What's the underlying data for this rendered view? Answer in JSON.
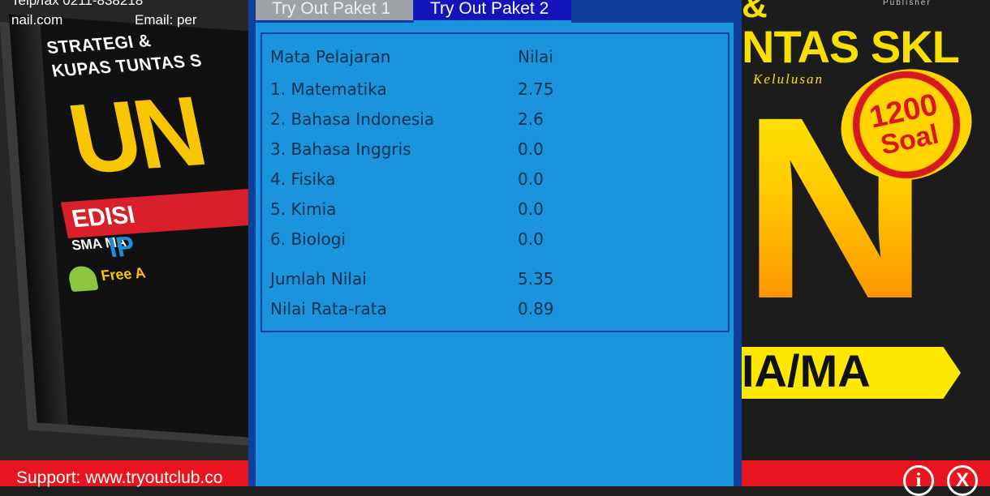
{
  "background_left": {
    "contact_top": "Telp/fax 0211-838218",
    "contact_email_left": "nail.com",
    "contact_email_right": "Email: per",
    "book_line1": "STRATEGI &",
    "book_line2": "KUPAS TUNTAS S",
    "book_big": "UN",
    "book_edition": "EDISI",
    "book_level": "SMA MA",
    "book_program": "IP",
    "book_free": "Free A"
  },
  "background_right": {
    "publisher": "Publisher",
    "amp": "&",
    "title": "NTAS SKL",
    "subtitle": "Kelulusan",
    "big_letter": "N",
    "seal_count": "1200",
    "seal_plus": "+",
    "seal_word": "Soal",
    "banner": "IA/MA"
  },
  "support": {
    "text": "Support: www.tryoutclub.co",
    "info_label": "i",
    "close_label": "X"
  },
  "tabs": [
    {
      "label": "Try Out Paket 1",
      "active": false
    },
    {
      "label": "Try Out Paket 2",
      "active": true
    }
  ],
  "scores": {
    "header": {
      "subject": "Mata Pelajaran",
      "value": "Nilai"
    },
    "rows": [
      {
        "subject": "1. Matematika",
        "value": "2.75"
      },
      {
        "subject": "2. Bahasa Indonesia",
        "value": "2.6"
      },
      {
        "subject": "3. Bahasa Inggris",
        "value": "0.0"
      },
      {
        "subject": "4. Fisika",
        "value": "0.0"
      },
      {
        "subject": "5. Kimia",
        "value": "0.0"
      },
      {
        "subject": "6. Biologi",
        "value": "0.0"
      }
    ],
    "total": {
      "label": "Jumlah Nilai",
      "value": "5.35"
    },
    "average": {
      "label": "Nilai Rata-rata",
      "value": "0.89"
    }
  },
  "colors": {
    "dialog_border": "#0e3f9c",
    "dialog_body": "#1a94dc",
    "tab_active": "#1414bd",
    "tab_inactive": "#9fa3a7",
    "support_bar": "#e8151e"
  }
}
